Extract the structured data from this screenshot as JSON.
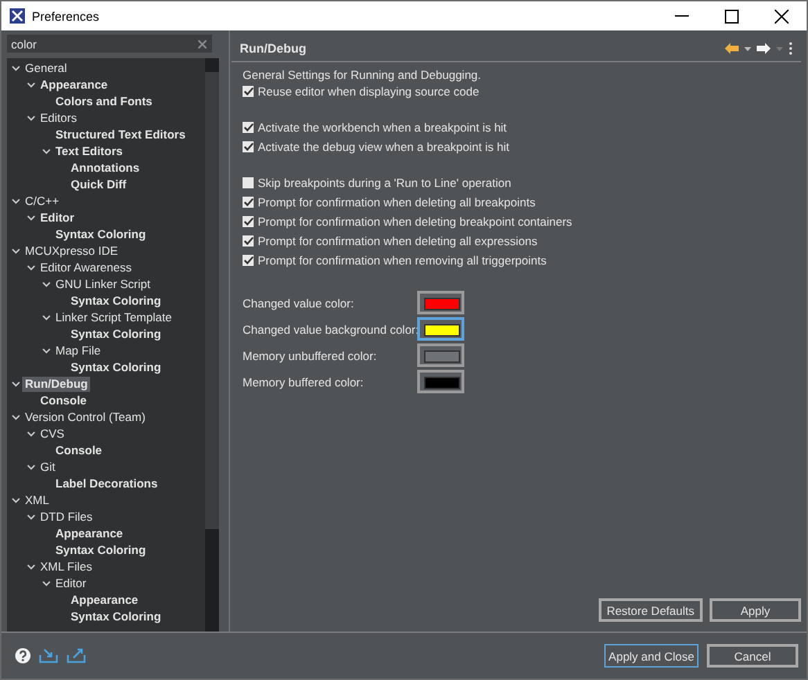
{
  "window": {
    "title": "Preferences"
  },
  "search": {
    "value": "color"
  },
  "tree": [
    {
      "label": "General",
      "bold": false,
      "selected": false,
      "expanded": true,
      "children": [
        {
          "label": "Appearance",
          "bold": true,
          "selected": false,
          "expanded": true,
          "children": [
            {
              "label": "Colors and Fonts",
              "bold": true,
              "selected": false
            }
          ]
        },
        {
          "label": "Editors",
          "bold": false,
          "selected": false,
          "expanded": true,
          "children": [
            {
              "label": "Structured Text Editors",
              "bold": true,
              "selected": false
            },
            {
              "label": "Text Editors",
              "bold": true,
              "selected": false,
              "expanded": true,
              "children": [
                {
                  "label": "Annotations",
                  "bold": true,
                  "selected": false
                },
                {
                  "label": "Quick Diff",
                  "bold": true,
                  "selected": false
                }
              ]
            }
          ]
        }
      ]
    },
    {
      "label": "C/C++",
      "bold": false,
      "selected": false,
      "expanded": true,
      "children": [
        {
          "label": "Editor",
          "bold": true,
          "selected": false,
          "expanded": true,
          "children": [
            {
              "label": "Syntax Coloring",
              "bold": true,
              "selected": false
            }
          ]
        }
      ]
    },
    {
      "label": "MCUXpresso IDE",
      "bold": false,
      "selected": false,
      "expanded": true,
      "children": [
        {
          "label": "Editor Awareness",
          "bold": false,
          "selected": false,
          "expanded": true,
          "children": [
            {
              "label": "GNU Linker Script",
              "bold": false,
              "selected": false,
              "expanded": true,
              "children": [
                {
                  "label": "Syntax Coloring",
                  "bold": true,
                  "selected": false
                }
              ]
            },
            {
              "label": "Linker Script Template",
              "bold": false,
              "selected": false,
              "expanded": true,
              "children": [
                {
                  "label": "Syntax Coloring",
                  "bold": true,
                  "selected": false
                }
              ]
            },
            {
              "label": "Map File",
              "bold": false,
              "selected": false,
              "expanded": true,
              "children": [
                {
                  "label": "Syntax Coloring",
                  "bold": true,
                  "selected": false
                }
              ]
            }
          ]
        }
      ]
    },
    {
      "label": "Run/Debug",
      "bold": true,
      "selected": true,
      "expanded": true,
      "children": [
        {
          "label": "Console",
          "bold": true,
          "selected": false
        }
      ]
    },
    {
      "label": "Version Control (Team)",
      "bold": false,
      "selected": false,
      "expanded": true,
      "children": [
        {
          "label": "CVS",
          "bold": false,
          "selected": false,
          "expanded": true,
          "children": [
            {
              "label": "Console",
              "bold": true,
              "selected": false
            }
          ]
        },
        {
          "label": "Git",
          "bold": false,
          "selected": false,
          "expanded": true,
          "children": [
            {
              "label": "Label Decorations",
              "bold": true,
              "selected": false
            }
          ]
        }
      ]
    },
    {
      "label": "XML",
      "bold": false,
      "selected": false,
      "expanded": true,
      "children": [
        {
          "label": "DTD Files",
          "bold": false,
          "selected": false,
          "expanded": true,
          "children": [
            {
              "label": "Appearance",
              "bold": true,
              "selected": false
            },
            {
              "label": "Syntax Coloring",
              "bold": true,
              "selected": false
            }
          ]
        },
        {
          "label": "XML Files",
          "bold": false,
          "selected": false,
          "expanded": true,
          "children": [
            {
              "label": "Editor",
              "bold": false,
              "selected": false,
              "expanded": true,
              "children": [
                {
                  "label": "Appearance",
                  "bold": true,
                  "selected": false
                },
                {
                  "label": "Syntax Coloring",
                  "bold": true,
                  "selected": false
                }
              ]
            }
          ]
        }
      ]
    }
  ],
  "page": {
    "title": "Run/Debug",
    "description": "General Settings for Running and Debugging.",
    "option_groups": [
      [
        {
          "label": "Reuse editor when displaying source code",
          "checked": true
        }
      ],
      [
        {
          "label": "Activate the workbench when a breakpoint is hit",
          "checked": true
        },
        {
          "label": "Activate the debug view when a breakpoint is hit",
          "checked": true
        }
      ],
      [
        {
          "label": "Skip breakpoints during a 'Run to Line' operation",
          "checked": false
        },
        {
          "label": "Prompt for confirmation when deleting all breakpoints",
          "checked": true
        },
        {
          "label": "Prompt for confirmation when deleting breakpoint containers",
          "checked": true
        },
        {
          "label": "Prompt for confirmation when deleting all expressions",
          "checked": true
        },
        {
          "label": "Prompt for confirmation when removing all triggerpoints",
          "checked": true
        }
      ]
    ],
    "colors": [
      {
        "label": "Changed value color:",
        "color": "#ff0000",
        "focused": false
      },
      {
        "label": "Changed value background color:",
        "color": "#ffff00",
        "focused": true
      },
      {
        "label": "Memory unbuffered color:",
        "color": "#6e7176",
        "focused": false
      },
      {
        "label": "Memory buffered color:",
        "color": "#000000",
        "focused": false
      }
    ],
    "buttons": [
      {
        "label": "Restore Defaults"
      },
      {
        "label": "Apply"
      }
    ]
  },
  "footer_buttons": [
    {
      "label": "Apply and Close",
      "default": true
    },
    {
      "label": "Cancel",
      "default": false
    }
  ]
}
